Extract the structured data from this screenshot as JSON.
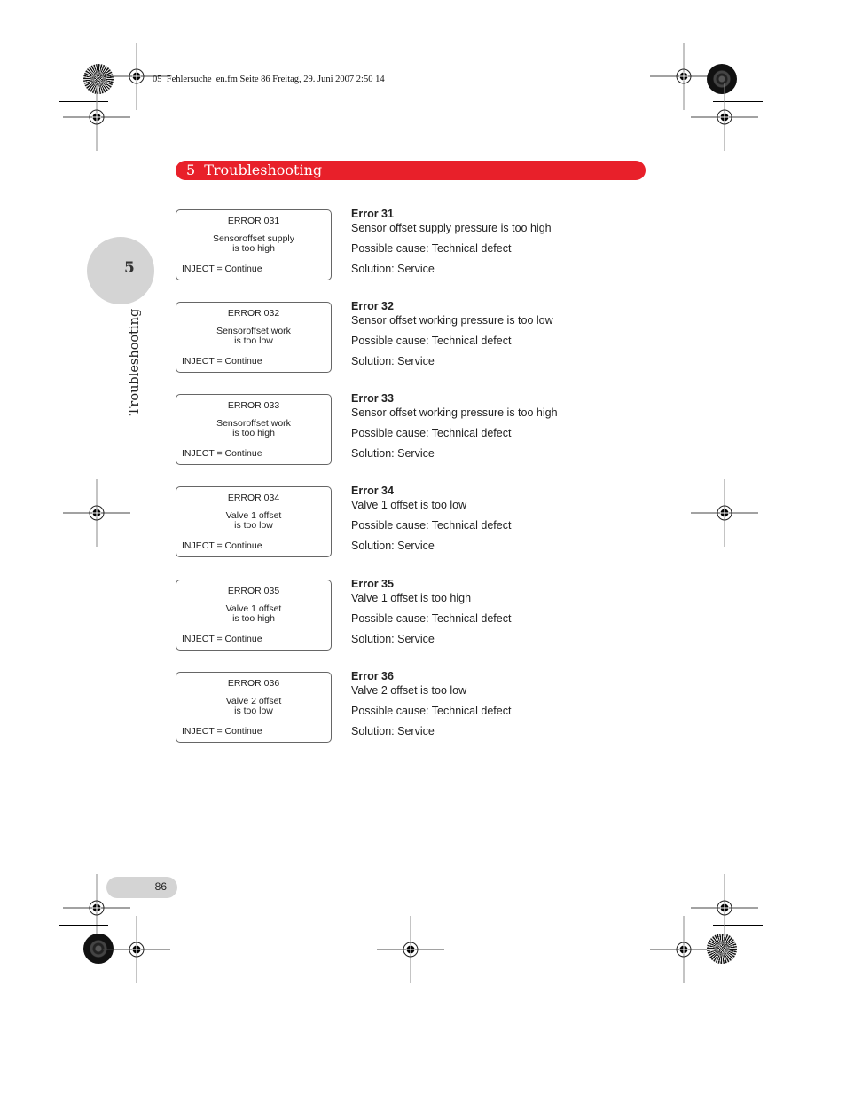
{
  "file_header": "05_Fehlersuche_en.fm  Seite 86  Freitag, 29. Juni 2007  2:50 14",
  "chapter": {
    "number": "5",
    "title": "Troubleshooting",
    "accent_color": "#e8202a"
  },
  "side_tab": {
    "number": "5",
    "label": "Troubleshooting"
  },
  "errors": [
    {
      "display_code": "ERROR 031",
      "display_line1": "Sensoroffset supply",
      "display_line2": "is too high",
      "display_action": "INJECT = Continue",
      "title": "Error 31",
      "description": "Sensor offset supply pressure is too high",
      "cause": "Possible cause: Technical defect",
      "solution": "Solution: Service"
    },
    {
      "display_code": "ERROR 032",
      "display_line1": "Sensoroffset work",
      "display_line2": "is too low",
      "display_action": "INJECT = Continue",
      "title": "Error 32",
      "description": "Sensor offset working pressure is too low",
      "cause": "Possible cause: Technical defect",
      "solution": "Solution: Service"
    },
    {
      "display_code": "ERROR 033",
      "display_line1": "Sensoroffset work",
      "display_line2": "is too high",
      "display_action": "INJECT = Continue",
      "title": "Error 33",
      "description": "Sensor offset working pressure is too high",
      "cause": "Possible cause: Technical defect",
      "solution": "Solution: Service"
    },
    {
      "display_code": "ERROR 034",
      "display_line1": "Valve 1 offset",
      "display_line2": "is too low",
      "display_action": "INJECT = Continue",
      "title": "Error 34",
      "description": "Valve 1 offset is too low",
      "cause": "Possible cause: Technical defect",
      "solution": "Solution: Service"
    },
    {
      "display_code": "ERROR 035",
      "display_line1": "Valve 1 offset",
      "display_line2": "is too high",
      "display_action": "INJECT = Continue",
      "title": "Error 35",
      "description": "Valve 1 offset is too high",
      "cause": "Possible cause: Technical defect",
      "solution": "Solution: Service"
    },
    {
      "display_code": "ERROR 036",
      "display_line1": "Valve 2 offset",
      "display_line2": "is too low",
      "display_action": "INJECT = Continue",
      "title": "Error 36",
      "description": "Valve 2 offset is too low",
      "cause": "Possible cause: Technical defect",
      "solution": "Solution: Service"
    }
  ],
  "page_number": "86"
}
